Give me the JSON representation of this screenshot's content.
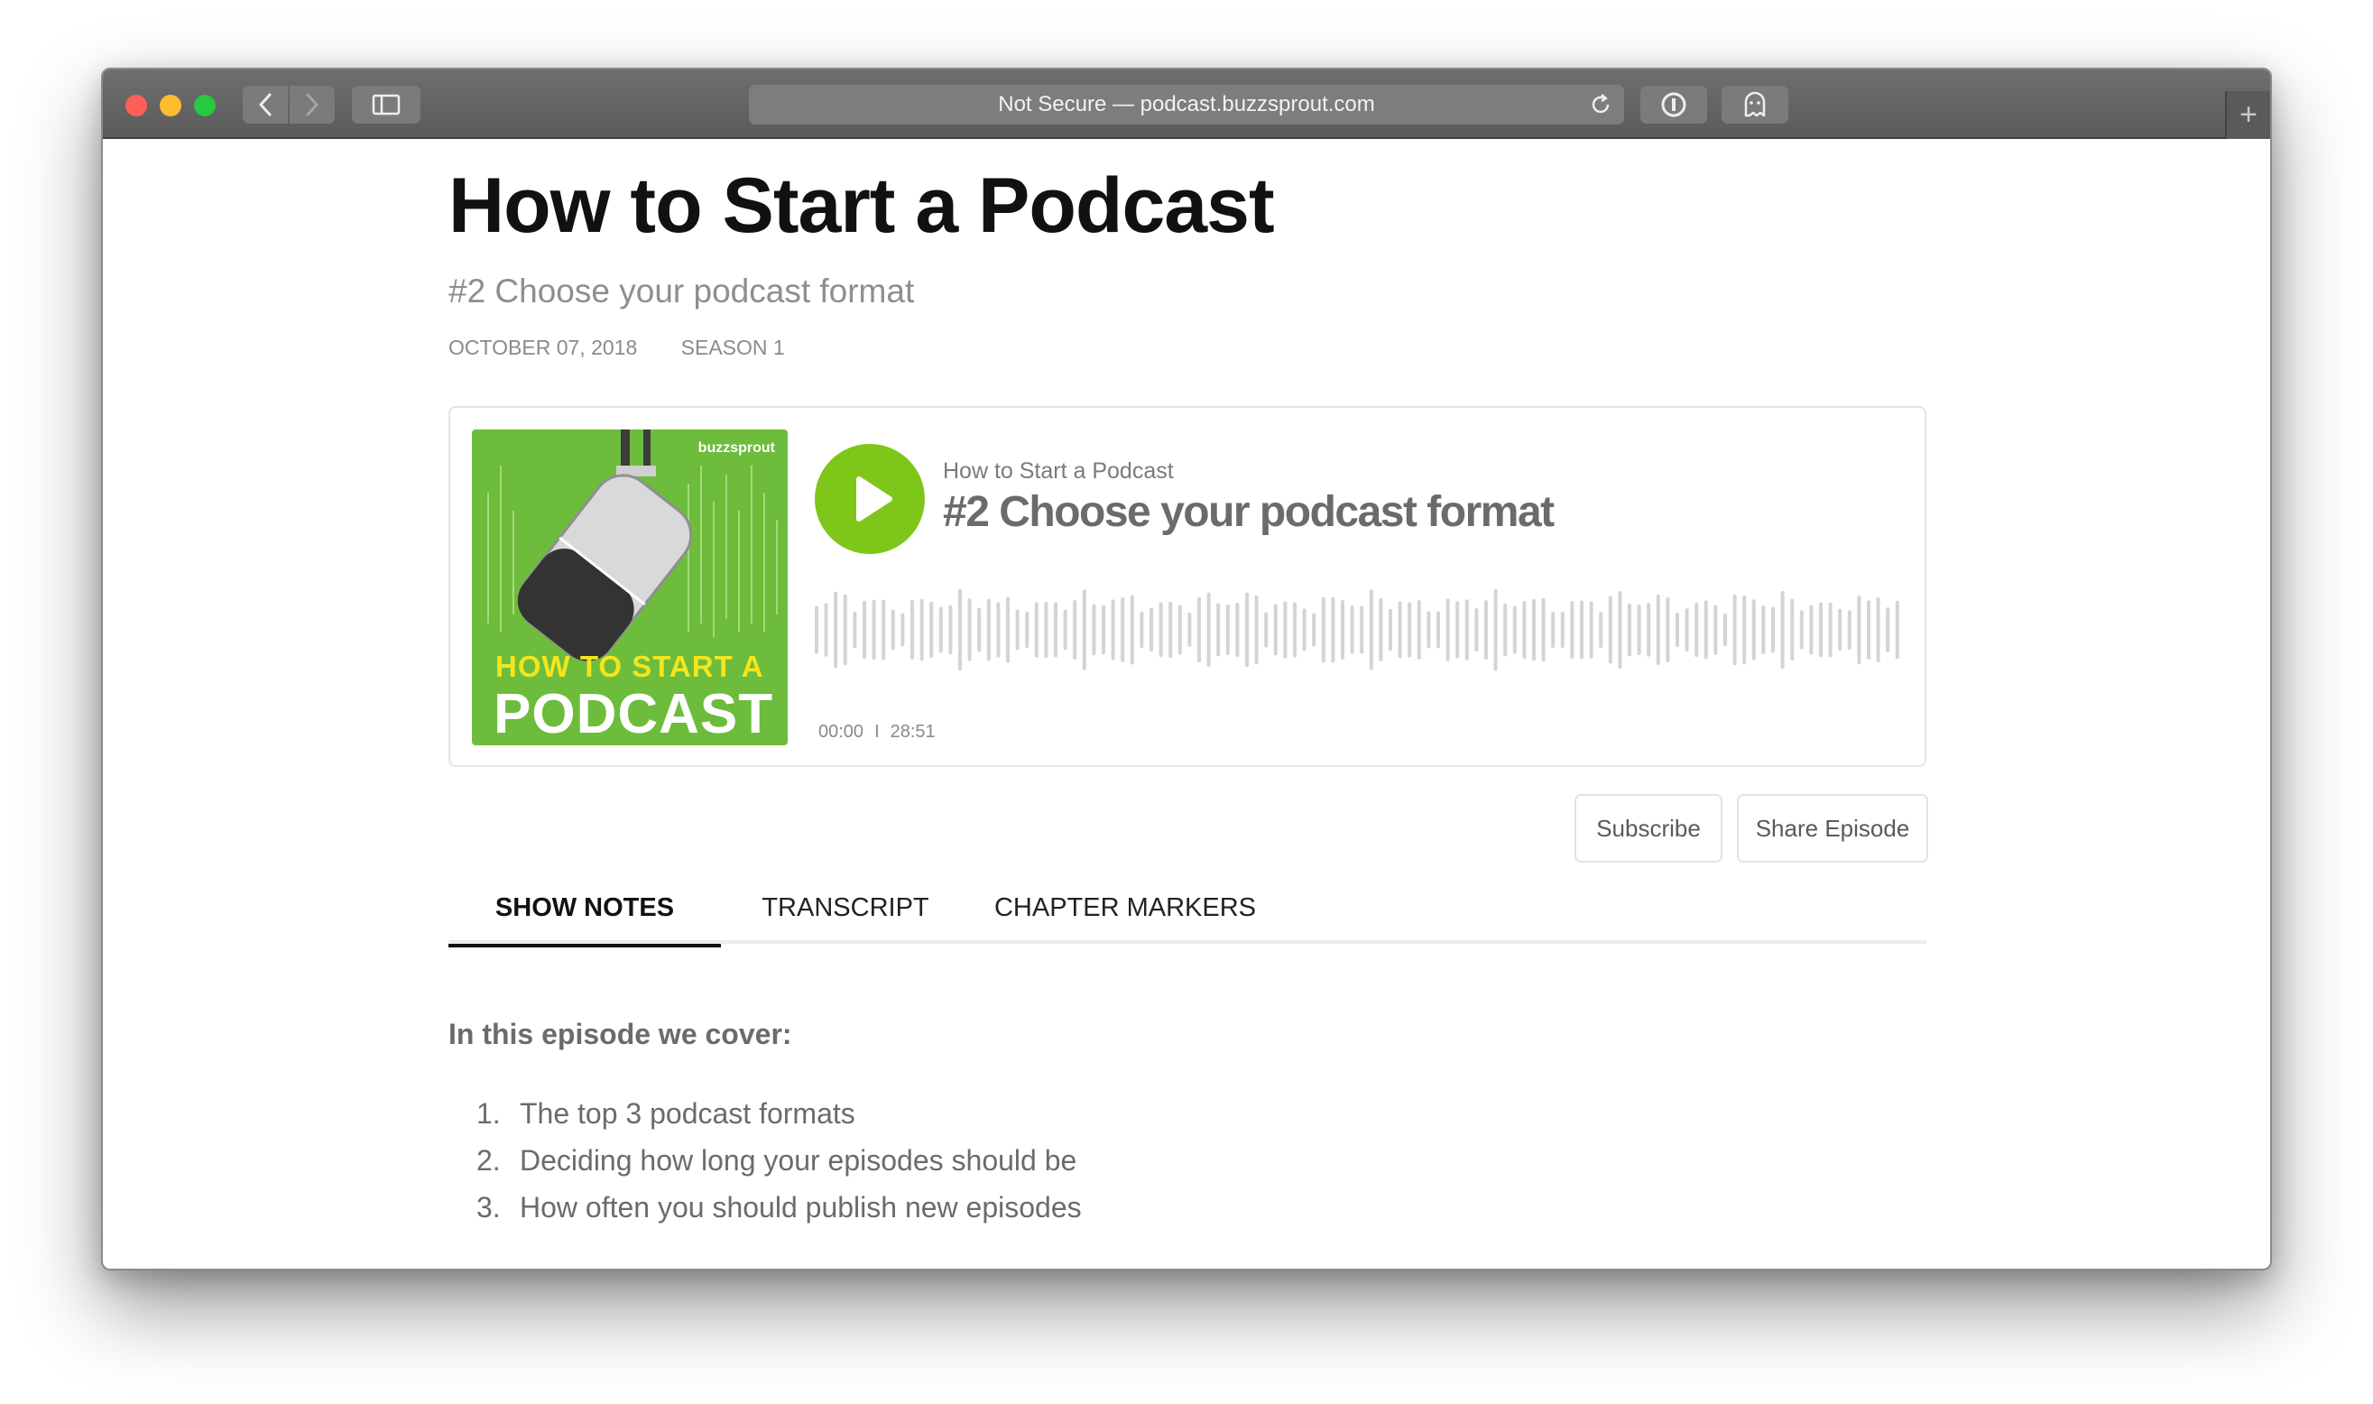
{
  "browser": {
    "address": "Not Secure — podcast.buzzsprout.com",
    "new_tab": "+"
  },
  "episode": {
    "title": "How to Start a Podcast",
    "subtitle": "#2 Choose your podcast format",
    "date": "OCTOBER 07, 2018",
    "season": "SEASON 1"
  },
  "player": {
    "artwork": {
      "brand": "buzzsprout",
      "line1": "HOW TO START A",
      "line2": "PODCAST",
      "background": "#6dbc3c"
    },
    "show_name": "How to Start a Podcast",
    "episode_title": "#2 Choose your podcast format",
    "current_time": "00:00",
    "separator": "I",
    "duration": "28:51",
    "progress": 0,
    "play_color": "#7fc61a"
  },
  "actions": {
    "subscribe": "Subscribe",
    "share": "Share Episode"
  },
  "tabs": [
    {
      "label": "SHOW NOTES",
      "active": true
    },
    {
      "label": "TRANSCRIPT",
      "active": false
    },
    {
      "label": "CHAPTER MARKERS",
      "active": false
    }
  ],
  "notes": {
    "heading": "In this episode we cover:",
    "items": [
      {
        "num": "1.",
        "text": "The top 3 podcast formats"
      },
      {
        "num": "2.",
        "text": "Deciding how long your episodes should be"
      },
      {
        "num": "3.",
        "text": "How often you should publish new episodes"
      }
    ]
  }
}
